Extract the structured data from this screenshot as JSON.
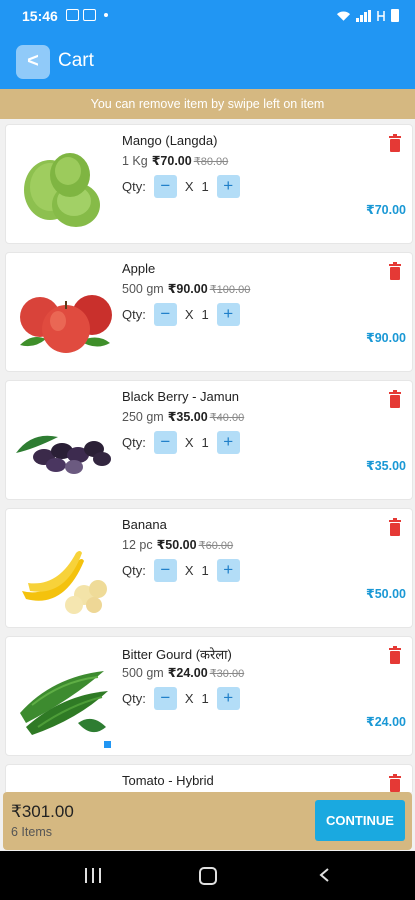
{
  "status_bar": {
    "time": "15:46",
    "icons": [
      "notification-icon",
      "photo-icon",
      "sim-icon",
      "wifi-icon",
      "signal-icon",
      "lte-icon",
      "battery-icon"
    ]
  },
  "header": {
    "back_label": "<",
    "title": "Cart"
  },
  "notice": "You can remove item by swipe left on item",
  "qty_label": "Qty:",
  "minus": "−",
  "plus": "+",
  "times": "X",
  "items": [
    {
      "name": "Mango (Langda)",
      "unit": "1 Kg",
      "price": "₹70.00",
      "mrp": "₹80.00",
      "qty": "1",
      "total": "₹70.00"
    },
    {
      "name": "Apple",
      "unit": "500 gm",
      "price": "₹90.00",
      "mrp": "₹100.00",
      "qty": "1",
      "total": "₹90.00"
    },
    {
      "name": "Black Berry - Jamun",
      "unit": "250 gm",
      "price": "₹35.00",
      "mrp": "₹40.00",
      "qty": "1",
      "total": "₹35.00"
    },
    {
      "name": "Banana",
      "unit": "12 pc",
      "price": "₹50.00",
      "mrp": "₹60.00",
      "qty": "1",
      "total": "₹50.00"
    },
    {
      "name": "Bitter Gourd  (करेला)",
      "unit": "500 gm",
      "price": "₹24.00",
      "mrp": "₹30.00",
      "qty": "1",
      "total": "₹24.00"
    },
    {
      "name": "Tomato - Hybrid"
    }
  ],
  "footer": {
    "total": "₹301.00",
    "items_count": "6 Items",
    "continue_label": "CONTINUE"
  },
  "colors": {
    "primary": "#2196f3",
    "tan": "#d5b881",
    "accent": "#1aa9e0",
    "delete": "#e53935"
  }
}
